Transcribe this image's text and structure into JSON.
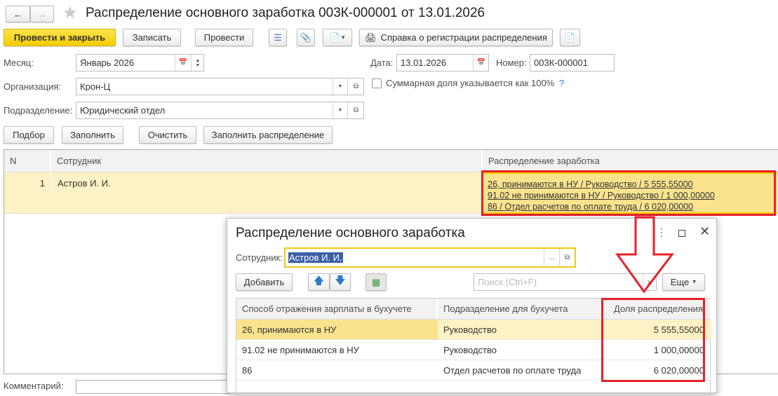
{
  "window": {
    "title": "Распределение основного заработка 003К-000001 от 13.01.2026"
  },
  "toolbar": {
    "post_close": "Провести и закрыть",
    "save": "Записать",
    "post": "Провести",
    "report": "Справка о регистрации распределения"
  },
  "form": {
    "month_label": "Месяц:",
    "month_value": "Январь 2026",
    "date_label": "Дата:",
    "date_value": "13.01.2026",
    "number_label": "Номер:",
    "number_value": "003К-000001",
    "org_label": "Организация:",
    "org_value": "Крон-Ц",
    "dept_label": "Подразделение:",
    "dept_value": "Юридический отдел",
    "sum_checkbox_label": "Суммарная доля указывается как 100%",
    "help": "?",
    "comment_label": "Комментарий:"
  },
  "actions": {
    "pick": "Подбор",
    "fill": "Заполнить",
    "clear": "Очистить",
    "fill_distribution": "Заполнить распределение"
  },
  "table": {
    "headers": [
      "N",
      "Сотрудник",
      "Распределение заработка"
    ],
    "rows": [
      {
        "n": "1",
        "employee": "Астров И. И.",
        "distribution": [
          "26, принимаются в НУ / Руководство / 5 555,55000",
          "91.02 не принимаются в НУ / Руководство / 1 000,00000",
          "86 / Отдел расчетов по оплате труда / 6 020,00000"
        ]
      }
    ]
  },
  "dialog": {
    "title": "Распределение основного заработка",
    "employee_label": "Сотрудник:",
    "employee_value": "Астров И. И.",
    "add": "Добавить",
    "search_placeholder": "Поиск (Ctrl+F)",
    "more": "Еще",
    "headers": [
      "Способ отражения зарплаты в бухучете",
      "Подразделение для бухучета",
      "Доля распределения"
    ],
    "rows": [
      {
        "method": "26, принимаются в НУ",
        "dept": "Руководство",
        "share": "5 555,55000"
      },
      {
        "method": "91.02 не принимаются в НУ",
        "dept": "Руководство",
        "share": "1 000,00000"
      },
      {
        "method": "86",
        "dept": "Отдел расчетов по оплате труда",
        "share": "6 020,00000"
      }
    ]
  },
  "colors": {
    "accent": "#f5cd00",
    "highlight": "#e8202a",
    "row_selected": "#fdf2c5"
  }
}
